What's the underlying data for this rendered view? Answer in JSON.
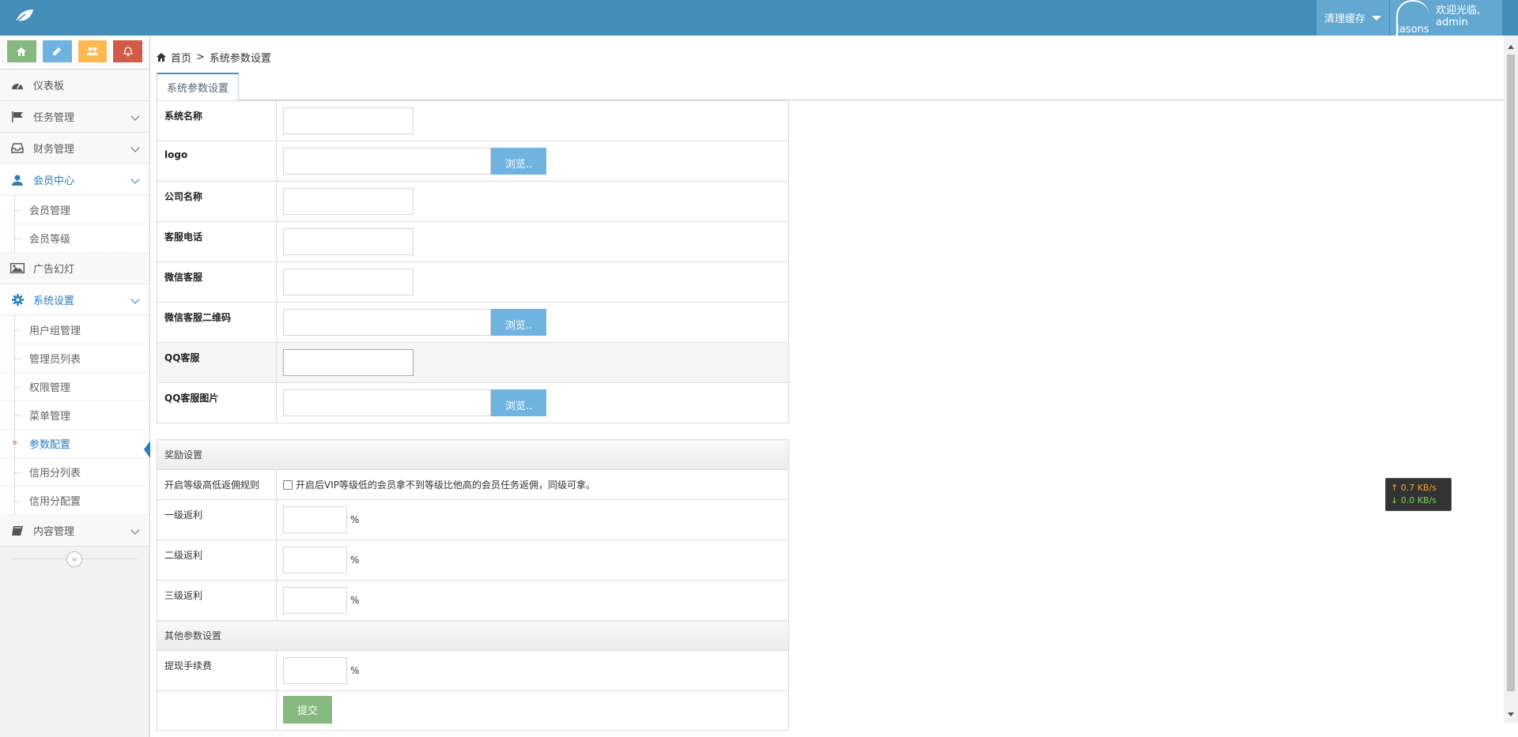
{
  "header": {
    "clear_cache_label": "清理缓存",
    "avatar_alt": "Jasons",
    "welcome_line1": "欢迎光临,",
    "welcome_line2": "admin",
    "bar_color": "#438eb9"
  },
  "shortcuts": [
    {
      "icon": "home-icon",
      "color": "#87b87f"
    },
    {
      "icon": "pencil-icon",
      "color": "#6fb3e0"
    },
    {
      "icon": "users-icon",
      "color": "#ffb752"
    },
    {
      "icon": "bell-icon",
      "color": "#d15b47"
    }
  ],
  "sidebar": {
    "dashboard": "仪表板",
    "task_mgmt": "任务管理",
    "finance_mgmt": "财务管理",
    "member_center": "会员中心",
    "member_sub": [
      "会员管理",
      "会员等级"
    ],
    "ad_slides": "广告幻灯",
    "system_settings": "系统设置",
    "system_sub": [
      "用户组管理",
      "管理员列表",
      "权限管理",
      "菜单管理",
      "参数配置",
      "信用分列表",
      "信用分配置"
    ],
    "content_mgmt": "内容管理"
  },
  "breadcrumb": {
    "home": "首页",
    "separator": ">",
    "current": "系统参数设置"
  },
  "tab_label": "系统参数设置",
  "form": {
    "system_name": "系统名称",
    "logo": "logo",
    "company_name": "公司名称",
    "service_phone": "客服电话",
    "wechat_service": "微信客服",
    "wechat_qr": "微信客服二维码",
    "qq_service": "QQ客服",
    "qq_image": "QQ客服图片",
    "browse": "浏览.."
  },
  "reward": {
    "section_title": "奖励设置",
    "rule_label": "开启等级高低返佣规则",
    "rule_checkbox_text": "开启后VIP等级低的会员拿不到等级比他高的会员任务返佣，同级可拿。",
    "level1": "一级返利",
    "level2": "二级返利",
    "level3": "三级返利",
    "percent": "%"
  },
  "other": {
    "section_title": "其他参数设置",
    "withdraw_fee": "提现手续费",
    "submit": "提交"
  },
  "speed_widget": {
    "up": "↑ 0.7 KB/s",
    "down": "↓ 0.0 KB/s"
  }
}
